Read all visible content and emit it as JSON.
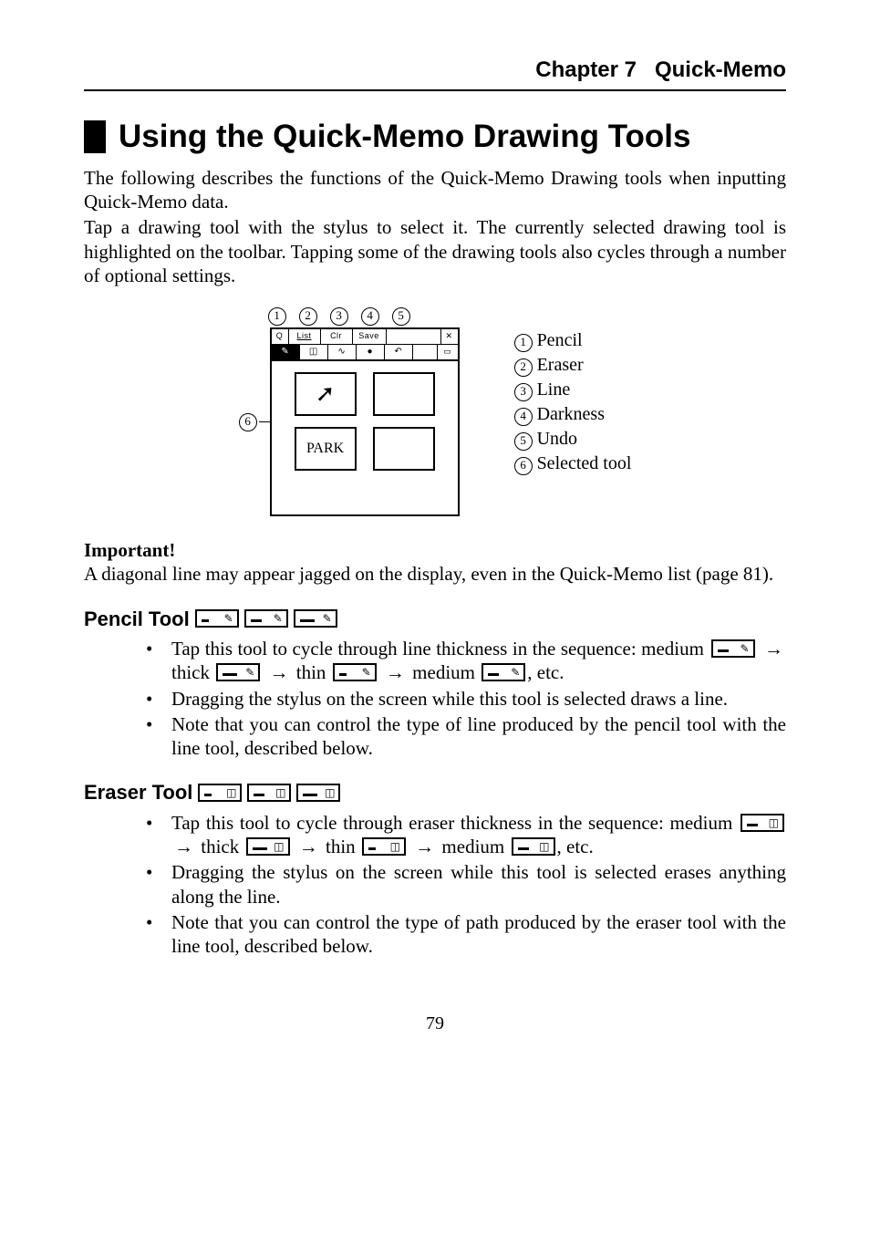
{
  "header": {
    "chapter": "Chapter 7",
    "subject": "Quick-Memo"
  },
  "section_title": "Using the Quick-Memo Drawing Tools",
  "intro": {
    "p1": "The following describes the functions of the Quick-Memo Drawing tools when inputting Quick-Memo data.",
    "p2": "Tap a drawing tool with the stylus to select it. The currently selected drawing tool is highlighted on the toolbar. Tapping some of the drawing tools also cycles through a number of optional settings."
  },
  "diagram": {
    "callouts": [
      "1",
      "2",
      "3",
      "4",
      "5"
    ],
    "six": "6",
    "top_buttons": {
      "q": "Q",
      "list": "List",
      "clr": "Clr",
      "save": "Save",
      "x": "✕"
    },
    "canvas_labels": [
      "",
      "PARK",
      ""
    ],
    "arrow_glyph": "➚"
  },
  "legend": {
    "items": [
      {
        "n": "1",
        "label": "Pencil"
      },
      {
        "n": "2",
        "label": "Eraser"
      },
      {
        "n": "3",
        "label": "Line"
      },
      {
        "n": "4",
        "label": "Darkness"
      },
      {
        "n": "5",
        "label": "Undo"
      },
      {
        "n": "6",
        "label": "Selected tool"
      }
    ]
  },
  "important": {
    "heading": "Important!",
    "text": "A diagonal line may appear jagged on the display, even in the Quick-Memo list (page 81)."
  },
  "pencil": {
    "heading": "Pencil Tool",
    "bullets": [
      {
        "pre": "Tap this tool to cycle through line thickness in the sequence: medium",
        "seq": {
          "a": "thick",
          "b": "thin",
          "c": "medium"
        },
        "post": ", etc."
      },
      {
        "text": "Dragging the stylus on the screen while this tool is selected draws a line."
      },
      {
        "text": "Note that you can control the type of line produced by the pencil tool with the line tool, described below."
      }
    ]
  },
  "eraser": {
    "heading": "Eraser Tool",
    "bullets": [
      {
        "pre": "Tap this tool to cycle through eraser thickness in the sequence: medium",
        "seq": {
          "a": "thick",
          "b": "thin",
          "c": "medium"
        },
        "post": ", etc."
      },
      {
        "text": "Dragging the stylus on the screen while this tool is selected erases anything along the line."
      },
      {
        "text": "Note that you can control the type of path produced by the eraser tool with the line tool, described below."
      }
    ]
  },
  "glyphs": {
    "arrow": "→",
    "pencil": "✎",
    "eraser": "◫",
    "undo": "↶",
    "dot": "●",
    "wave": "∿",
    "menu": "▭"
  },
  "page_number": "79"
}
